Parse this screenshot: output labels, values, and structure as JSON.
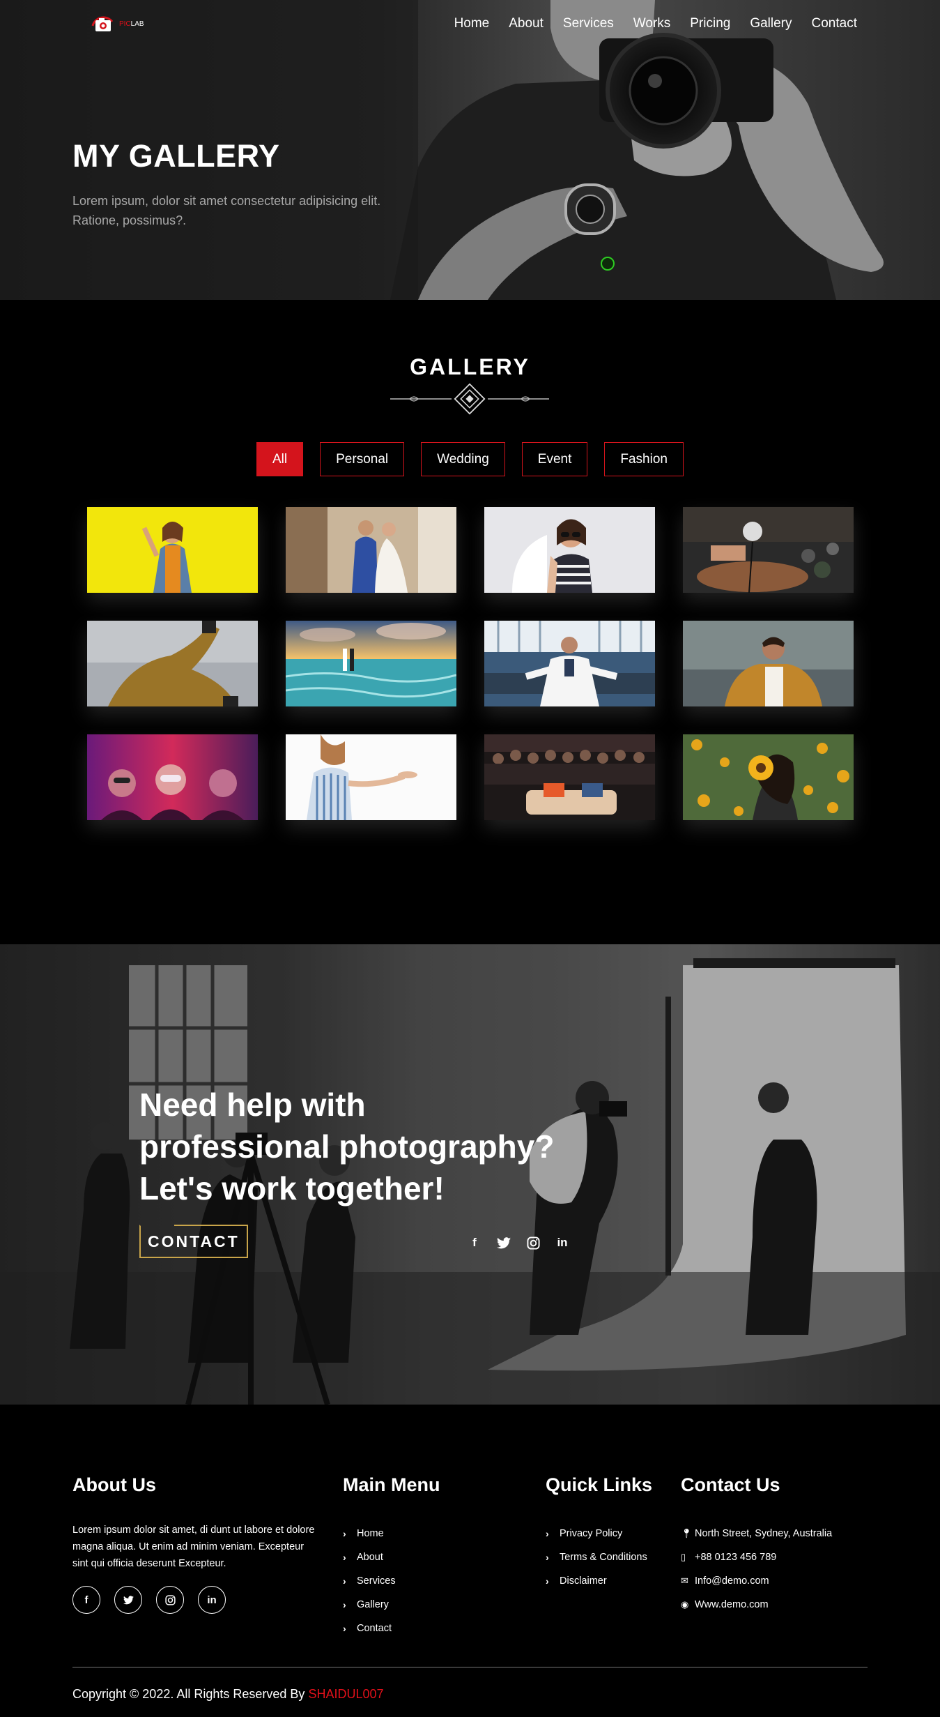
{
  "brand": {
    "logo_prefix": "PIC",
    "logo_suffix": "LAB"
  },
  "nav": {
    "items": [
      "Home",
      "About",
      "Services",
      "Works",
      "Pricing",
      "Gallery",
      "Contact"
    ]
  },
  "hero": {
    "title": "MY GALLERY",
    "subtitle": "Lorem ipsum, dolor sit amet consectetur adipisicing elit. Ratione, possimus?."
  },
  "gallery": {
    "title": "GALLERY",
    "filters": [
      "All",
      "Personal",
      "Wedding",
      "Event",
      "Fashion"
    ],
    "active_filter": "All",
    "images": [
      {
        "subject": "woman-denim-jacket-yellow-bg"
      },
      {
        "subject": "wedding-couple-dancing"
      },
      {
        "subject": "woman-sunglasses-striped-shirt"
      },
      {
        "subject": "event-photo-shoot-crowd"
      },
      {
        "subject": "person-jumping-sky"
      },
      {
        "subject": "couple-beach-sunset"
      },
      {
        "subject": "man-white-suit-bench"
      },
      {
        "subject": "man-mustard-jacket-beach"
      },
      {
        "subject": "party-masks-pink-lights"
      },
      {
        "subject": "woman-striped-dress-white-bg"
      },
      {
        "subject": "nightclub-crowd-sofa"
      },
      {
        "subject": "woman-sunflowers"
      }
    ]
  },
  "cta": {
    "heading_lines": [
      "Need help with",
      "professional photography?",
      "Let's work together!"
    ],
    "button": "CONTACT",
    "social": [
      "facebook-icon",
      "twitter-icon",
      "instagram-icon",
      "linkedin-icon"
    ]
  },
  "footer": {
    "about": {
      "heading": "About Us",
      "text": "Lorem ipsum dolor sit amet, di dunt ut labore et dolore magna aliqua. Ut enim ad minim veniam. Excepteur sint qui officia deserunt Excepteur."
    },
    "main_menu": {
      "heading": "Main Menu",
      "items": [
        "Home",
        "About",
        "Services",
        "Gallery",
        "Contact"
      ]
    },
    "quick_links": {
      "heading": "Quick Links",
      "items": [
        "Privacy Policy",
        "Terms & Conditions",
        "Disclaimer"
      ]
    },
    "contact": {
      "heading": "Contact Us",
      "address": "North Street, Sydney, Australia",
      "phone": "+88 0123 456 789",
      "email": "Info@demo.com",
      "website": "Www.demo.com"
    },
    "copyright_prefix": "Copyright © 2022. All Rights Reserved By",
    "copyright_author": "SHAIDUL007"
  },
  "colors": {
    "accent": "#d4141c",
    "gold": "#c9a54a",
    "status_dot": "#2ecc22"
  }
}
